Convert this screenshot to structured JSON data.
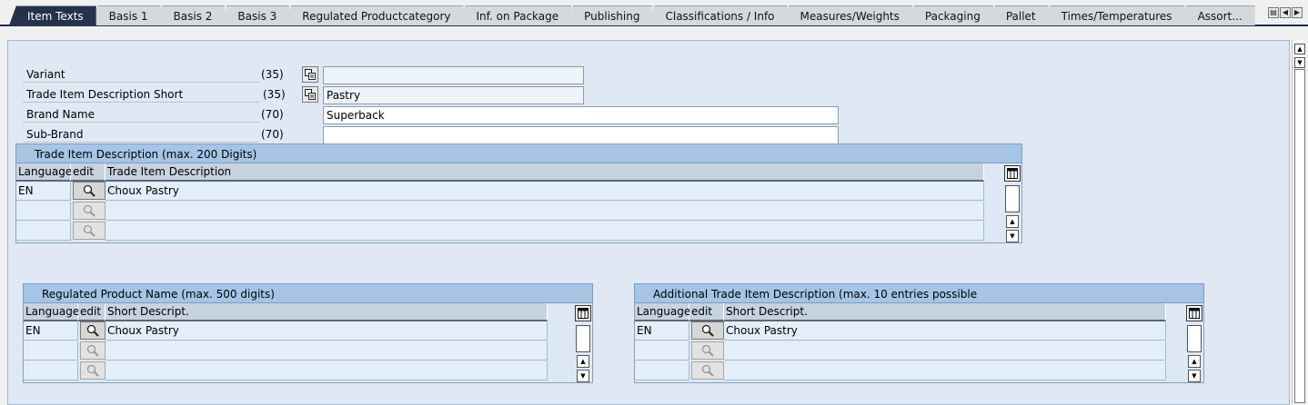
{
  "tabs": [
    {
      "label": "Item Texts",
      "active": true
    },
    {
      "label": "Basis 1"
    },
    {
      "label": "Basis 2"
    },
    {
      "label": "Basis 3"
    },
    {
      "label": "Regulated Productcategory"
    },
    {
      "label": "Inf. on Package"
    },
    {
      "label": "Publishing"
    },
    {
      "label": "Classifications / Info"
    },
    {
      "label": "Measures/Weights"
    },
    {
      "label": "Packaging"
    },
    {
      "label": "Pallet"
    },
    {
      "label": "Times/Temperatures"
    },
    {
      "label": "Assort..."
    }
  ],
  "form": {
    "variant": {
      "label": "Variant",
      "length": "(35)",
      "value": ""
    },
    "short_desc": {
      "label": "Trade Item Description Short",
      "length": "(35)",
      "value": "Pastry"
    },
    "brand": {
      "label": "Brand Name",
      "length": "(70)",
      "value": "Superback"
    },
    "subbrand": {
      "label": "Sub-Brand",
      "length": "(70)",
      "value": ""
    }
  },
  "table_desc": {
    "caption": "Trade Item Description (max. 200 Digits)",
    "col_language": "Language",
    "col_edit": "edit",
    "col_text": "Trade Item Description",
    "rows": [
      {
        "language": "EN",
        "text": "Choux Pastry"
      },
      {
        "language": "",
        "text": ""
      },
      {
        "language": "",
        "text": ""
      }
    ]
  },
  "table_regulated": {
    "caption": "Regulated Product Name (max. 500 digits)",
    "col_language": "Language",
    "col_edit": "edit",
    "col_text": "Short Descript.",
    "rows": [
      {
        "language": "EN",
        "text": "Choux Pastry"
      },
      {
        "language": "",
        "text": ""
      },
      {
        "language": "",
        "text": ""
      }
    ]
  },
  "table_additional": {
    "caption": "Additional Trade Item Description  (max. 10 entries possible",
    "col_language": "Language",
    "col_edit": "edit",
    "col_text": "Short Descript.",
    "rows": [
      {
        "language": "EN",
        "text": "Choux Pastry"
      },
      {
        "language": "",
        "text": ""
      },
      {
        "language": "",
        "text": ""
      }
    ]
  },
  "icons": {
    "copy": "copy-icon",
    "search": "magnifier-icon",
    "table_settings": "table-settings-icon"
  },
  "colors": {
    "active_tab": "#25324a",
    "panel": "#dfe8f3",
    "caption": "#a6c4e4"
  }
}
